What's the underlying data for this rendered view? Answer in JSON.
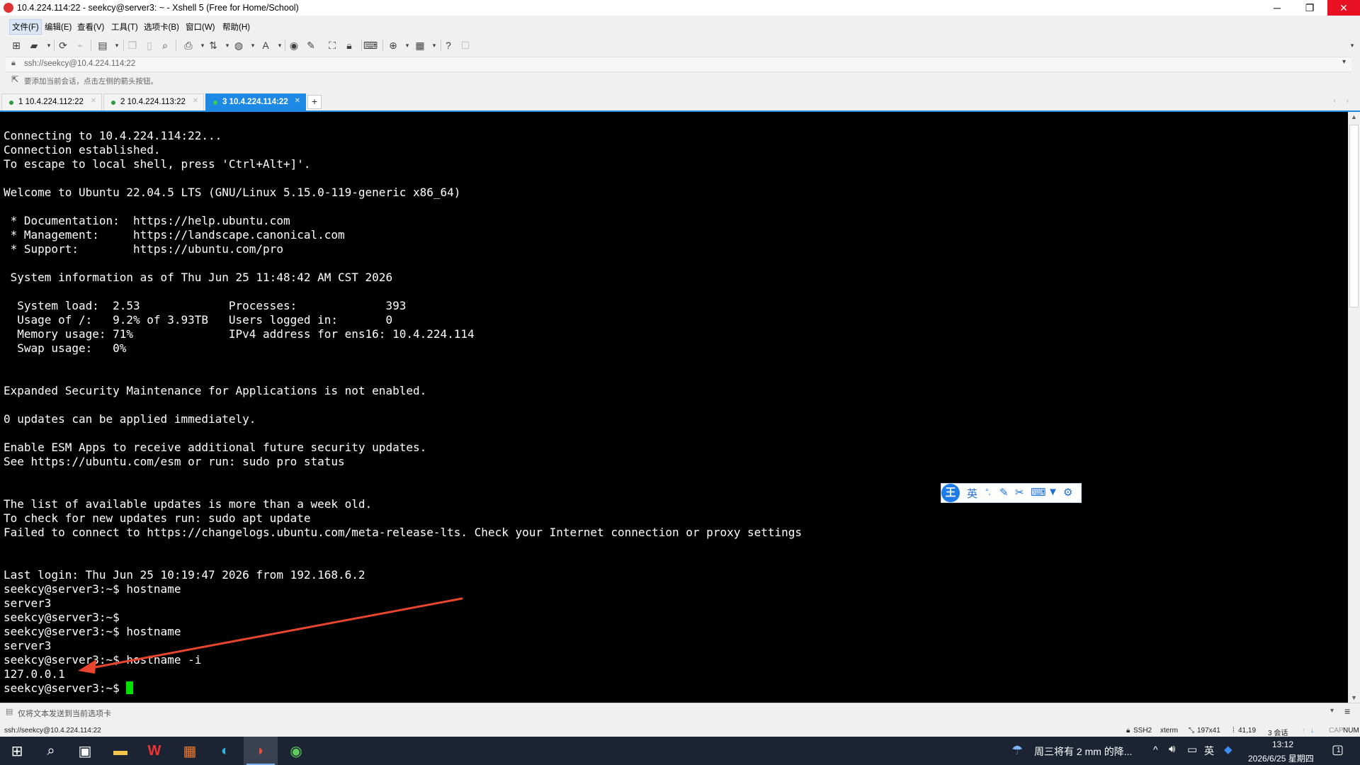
{
  "window": {
    "title": "10.4.224.114:22 - seekcy@server3: ~ - Xshell 5 (Free for Home/School)",
    "controls": {
      "minimize": "─",
      "restore": "❐",
      "close": "✕"
    }
  },
  "menubar": {
    "items": [
      "文件(F)",
      "编辑(E)",
      "查看(V)",
      "工具(T)",
      "选项卡(B)",
      "窗口(W)",
      "帮助(H)"
    ]
  },
  "address_bar": {
    "value": "ssh://seekcy@10.4.224.114:22",
    "dropdown_icon": "▾"
  },
  "hint_bar": {
    "text": "要添加当前会话，点击左侧的箭头按钮。"
  },
  "tabs": [
    {
      "label": "1 10.4.224.112:22",
      "active": false,
      "status_color": "#2a9d3a"
    },
    {
      "label": "2 10.4.224.113:22",
      "active": false,
      "status_color": "#2a9d3a"
    },
    {
      "label": "3 10.4.224.114:22",
      "active": true,
      "status_color": "#37d04e"
    }
  ],
  "tab_add_label": "+",
  "tab_nav": "‹ ›",
  "terminal": {
    "lines": [
      "Connecting to 10.4.224.114:22...",
      "Connection established.",
      "To escape to local shell, press 'Ctrl+Alt+]'.",
      "",
      "Welcome to Ubuntu 22.04.5 LTS (GNU/Linux 5.15.0-119-generic x86_64)",
      "",
      " * Documentation:  https://help.ubuntu.com",
      " * Management:     https://landscape.canonical.com",
      " * Support:        https://ubuntu.com/pro",
      "",
      " System information as of Thu Jun 25 11:48:42 AM CST 2026",
      "",
      "  System load:  2.53             Processes:             393",
      "  Usage of /:   9.2% of 3.93TB   Users logged in:       0",
      "  Memory usage: 71%              IPv4 address for ens16: 10.4.224.114",
      "  Swap usage:   0%",
      "",
      "",
      "Expanded Security Maintenance for Applications is not enabled.",
      "",
      "0 updates can be applied immediately.",
      "",
      "Enable ESM Apps to receive additional future security updates.",
      "See https://ubuntu.com/esm or run: sudo pro status",
      "",
      "",
      "The list of available updates is more than a week old.",
      "To check for new updates run: sudo apt update",
      "Failed to connect to https://changelogs.ubuntu.com/meta-release-lts. Check your Internet connection or proxy settings",
      "",
      "",
      "Last login: Thu Jun 25 10:19:47 2026 from 192.168.6.2",
      "seekcy@server3:~$ hostname",
      "server3",
      "seekcy@server3:~$",
      "seekcy@server3:~$ hostname",
      "server3",
      "seekcy@server3:~$ hostname -i",
      "127.0.0.1"
    ],
    "prompt": "seekcy@server3:~$ ",
    "background": "#000000",
    "foreground": "#ffffff",
    "cursor_color": "#00e000"
  },
  "ime_toolbar": {
    "logo": "王",
    "mode": "英",
    "punct": "°,",
    "icons": [
      "pen-icon",
      "scissors-icon",
      "keyboard-icon",
      "shirt-icon",
      "gear-icon"
    ]
  },
  "annotation": {
    "color": "#e8452e"
  },
  "send_bar": {
    "text": "仅将文本发送到当前选项卡"
  },
  "status_bar": {
    "connection": "ssh://seekcy@10.4.224.114:22",
    "protocol": "SSH2",
    "terminal_type": "xterm",
    "size": "197x41",
    "cursor_pos": "41,19",
    "sessions": "3 会话",
    "caps": "CAP",
    "num": "NUM"
  },
  "taskbar": {
    "weather": "周三将有 2 mm 的降...",
    "clock_time": "13:12",
    "clock_date": "2026/6/25 星期四",
    "ime_label": "英",
    "notification_count": "1"
  }
}
